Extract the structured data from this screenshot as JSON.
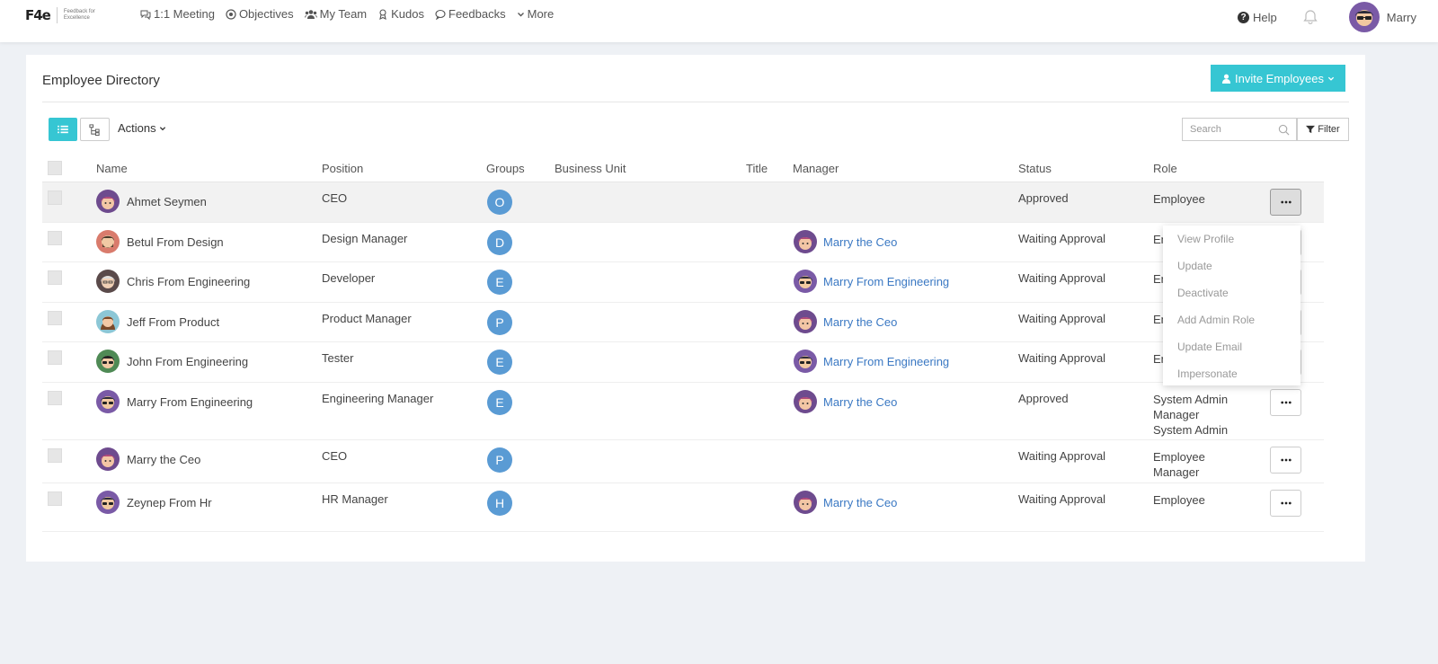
{
  "header": {
    "logo_mark": "F4e",
    "logo_tagline": "Feedback for Excellence",
    "nav": [
      {
        "label": "1:1 Meeting",
        "icon": "chat-icon"
      },
      {
        "label": "Objectives",
        "icon": "target-icon"
      },
      {
        "label": "My Team",
        "icon": "team-icon"
      },
      {
        "label": "Kudos",
        "icon": "kudos-icon"
      },
      {
        "label": "Feedbacks",
        "icon": "comment-icon"
      },
      {
        "label": "More",
        "icon": "chevron-down-icon"
      }
    ],
    "help_label": "Help",
    "user_name": "Marry"
  },
  "page": {
    "title": "Employee Directory",
    "invite_label": "Invite Employees",
    "actions_label": "Actions",
    "search_placeholder": "Search",
    "filter_label": "Filter"
  },
  "table": {
    "columns": [
      "Name",
      "Position",
      "Groups",
      "Business Unit",
      "Title",
      "Manager",
      "Status",
      "Role"
    ],
    "rows": [
      {
        "name": "Ahmet Seymen",
        "position": "CEO",
        "group": "O",
        "manager": "",
        "status": "Approved",
        "role": [
          "Employee"
        ],
        "avatar": "purple"
      },
      {
        "name": "Betul From Design",
        "position": "Design Manager",
        "group": "D",
        "manager": "Marry the Ceo",
        "status": "Waiting Approval",
        "role": [
          "Employee"
        ],
        "avatar": "beard"
      },
      {
        "name": "Chris From Engineering",
        "position": "Developer",
        "group": "E",
        "manager": "Marry From Engineering",
        "status": "Waiting Approval",
        "role": [
          "Employee"
        ],
        "avatar": "grey"
      },
      {
        "name": "Jeff From Product",
        "position": "Product Manager",
        "group": "P",
        "manager": "Marry the Ceo",
        "status": "Waiting Approval",
        "role": [
          "Employee"
        ],
        "avatar": "girl"
      },
      {
        "name": "John From Engineering",
        "position": "Tester",
        "group": "E",
        "manager": "Marry From Engineering",
        "status": "Waiting Approval",
        "role": [
          "Employee"
        ],
        "avatar": "green"
      },
      {
        "name": "Marry From Engineering",
        "position": "Engineering Manager",
        "group": "E",
        "manager": "Marry the Ceo",
        "status": "Approved",
        "role": [
          "System Admin",
          "Manager",
          "System Admin"
        ],
        "avatar": "shades"
      },
      {
        "name": "Marry the Ceo",
        "position": "CEO",
        "group": "P",
        "manager": "",
        "status": "Waiting Approval",
        "role": [
          "Employee",
          "Manager"
        ],
        "avatar": "purple"
      },
      {
        "name": "Zeynep From Hr",
        "position": "HR Manager",
        "group": "H",
        "manager": "Marry the Ceo",
        "status": "Waiting Approval",
        "role": [
          "Employee"
        ],
        "avatar": "shades"
      }
    ]
  },
  "row_menu": {
    "items": [
      "View Profile",
      "Update",
      "Deactivate",
      "Add Admin Role",
      "Update Email",
      "Impersonate"
    ]
  },
  "colors": {
    "accent": "#36c6d3",
    "group_badge": "#5a9bd4",
    "link": "#3a78c3"
  }
}
